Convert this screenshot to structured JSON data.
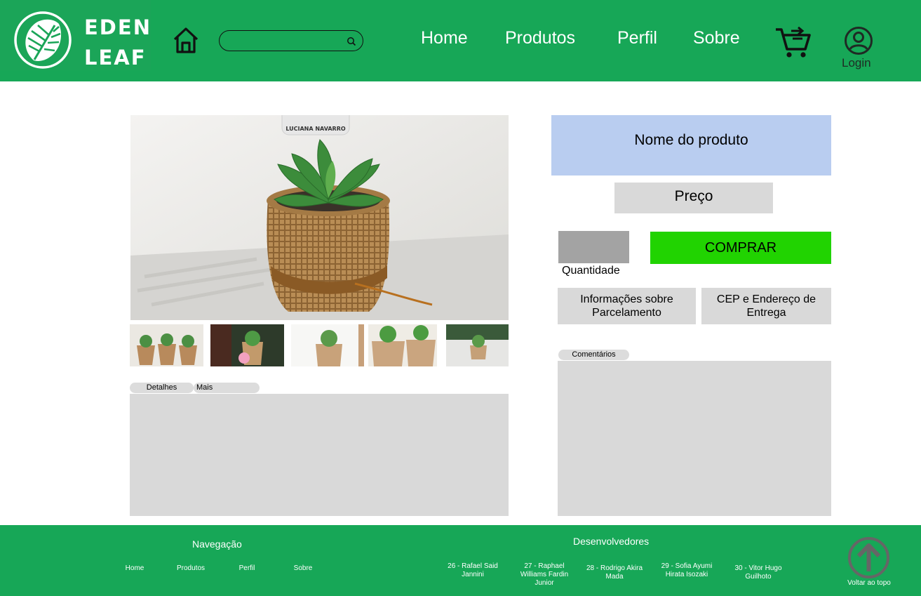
{
  "header": {
    "logo_line1": "EDEN",
    "logo_line2": "LEAF",
    "search_placeholder": "",
    "nav": [
      "Home",
      "Produtos",
      "Perfil",
      "Sobre"
    ],
    "login_label": "Login"
  },
  "product": {
    "name": "Nome do produto",
    "price": "Preço",
    "quantity_label": "Quantidade",
    "buy_label": "COMPRAR",
    "installments_label": "Informações sobre Parcelamento",
    "shipping_label": "CEP e Endereço de Entrega",
    "tag_text": "LUCIANA NAVARRO"
  },
  "tabs": {
    "details": "Detalhes",
    "recommendations": "Mais recomendações"
  },
  "comments": {
    "label": "Comentários"
  },
  "footer": {
    "nav_title": "Navegação",
    "nav_links": [
      "Home",
      "Produtos",
      "Perfil",
      "Sobre"
    ],
    "devs_title": "Desenvolvedores",
    "devs": [
      "26 - Rafael Said Jannini",
      "27 - Raphael Williams Fardin Junior",
      "28 - Rodrigo Akira Mada",
      "29 - Sofia Ayumi Hirata Isozaki",
      "30 - Vitor Hugo Guilhoto"
    ],
    "back_to_top": "Voltar ao topo"
  },
  "colors": {
    "brand_green": "#17a757",
    "buy_green": "#21d301",
    "name_blue": "#b9cdf0",
    "panel_gray": "#d9d9d9",
    "quantity_gray": "#a3a3a3"
  },
  "icons": [
    "leaf-logo-icon",
    "house-icon",
    "search-icon",
    "cart-icon",
    "user-circle-icon",
    "arrow-up-circle-icon"
  ]
}
